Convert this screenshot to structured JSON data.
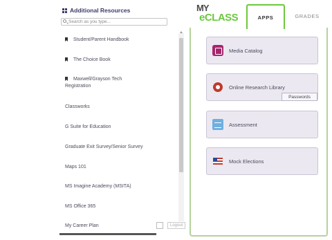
{
  "resources": {
    "title": "Additional Resources",
    "search_placeholder": "Search as you type...",
    "items": [
      {
        "label": "Student/Parent Handbook",
        "bookmark": true
      },
      {
        "label": "The Choice Book",
        "bookmark": true
      },
      {
        "label": "Maxwell/Grayson Tech Registration",
        "bookmark": true
      },
      {
        "label": "Classworks",
        "bookmark": false
      },
      {
        "label": "G Suite for Education",
        "bookmark": false
      },
      {
        "label": "Graduate Exit Survey/Senior Survey",
        "bookmark": false
      },
      {
        "label": "Maps 101",
        "bookmark": false
      },
      {
        "label": "MS Imagine Academy (MSITA)",
        "bookmark": false
      },
      {
        "label": "MS Office 365",
        "bookmark": false
      },
      {
        "label": "My Career Plan",
        "bookmark": false
      }
    ],
    "icons": {
      "header": "grid-icon",
      "search": "search-icon",
      "item": "bookmark-icon"
    }
  },
  "myeclass": {
    "logo_top": "MY",
    "logo_bottom": "eCLASS",
    "tabs": [
      {
        "label": "APPS",
        "active": true
      },
      {
        "label": "GRADES",
        "active": false
      }
    ],
    "apps": [
      {
        "label": "Media Catalog",
        "icon": "media-catalog-icon"
      },
      {
        "label": "Online Research Library",
        "icon": "research-library-icon"
      },
      {
        "label": "Assessment",
        "icon": "assessment-icon"
      },
      {
        "label": "Mock Elections",
        "icon": "flag-icon"
      }
    ],
    "passwords_link": "Passwords",
    "logout_label": "Logout"
  },
  "colors": {
    "brand_green": "#6cc83e",
    "app_button_bg": "#ece8f1",
    "title_navy": "#3b3b6b"
  }
}
